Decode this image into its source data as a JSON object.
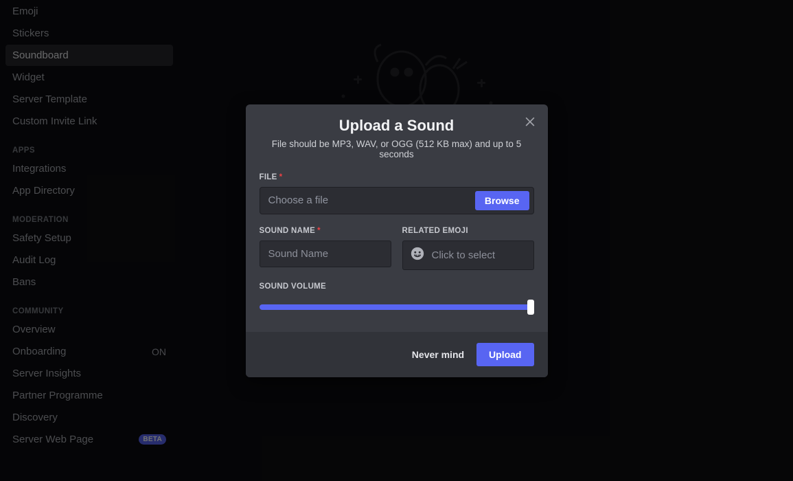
{
  "sidebar": {
    "items_top": [
      {
        "label": "Emoji"
      },
      {
        "label": "Stickers"
      },
      {
        "label": "Soundboard",
        "active": true
      },
      {
        "label": "Widget"
      },
      {
        "label": "Server Template"
      },
      {
        "label": "Custom Invite Link"
      }
    ],
    "section_apps": {
      "title": "APPS",
      "items": [
        {
          "label": "Integrations"
        },
        {
          "label": "App Directory"
        }
      ]
    },
    "section_moderation": {
      "title": "MODERATION",
      "items": [
        {
          "label": "Safety Setup"
        },
        {
          "label": "Audit Log"
        },
        {
          "label": "Bans"
        }
      ]
    },
    "section_community": {
      "title": "COMMUNITY",
      "items": [
        {
          "label": "Overview"
        },
        {
          "label": "Onboarding",
          "status": "ON"
        },
        {
          "label": "Server Insights"
        },
        {
          "label": "Partner Programme"
        },
        {
          "label": "Discovery"
        },
        {
          "label": "Server Web Page",
          "badge": "BETA"
        }
      ]
    }
  },
  "dialog": {
    "title": "Upload a Sound",
    "subtitle": "File should be MP3, WAV, or OGG (512 KB max) and up to 5 seconds",
    "file_label": "FILE",
    "file_placeholder": "Choose a file",
    "browse": "Browse",
    "name_label": "SOUND NAME",
    "name_placeholder": "Sound Name",
    "emoji_label": "RELATED EMOJI",
    "emoji_placeholder": "Click to select",
    "volume_label": "SOUND VOLUME",
    "volume_value": 100,
    "cancel": "Never mind",
    "upload": "Upload"
  }
}
